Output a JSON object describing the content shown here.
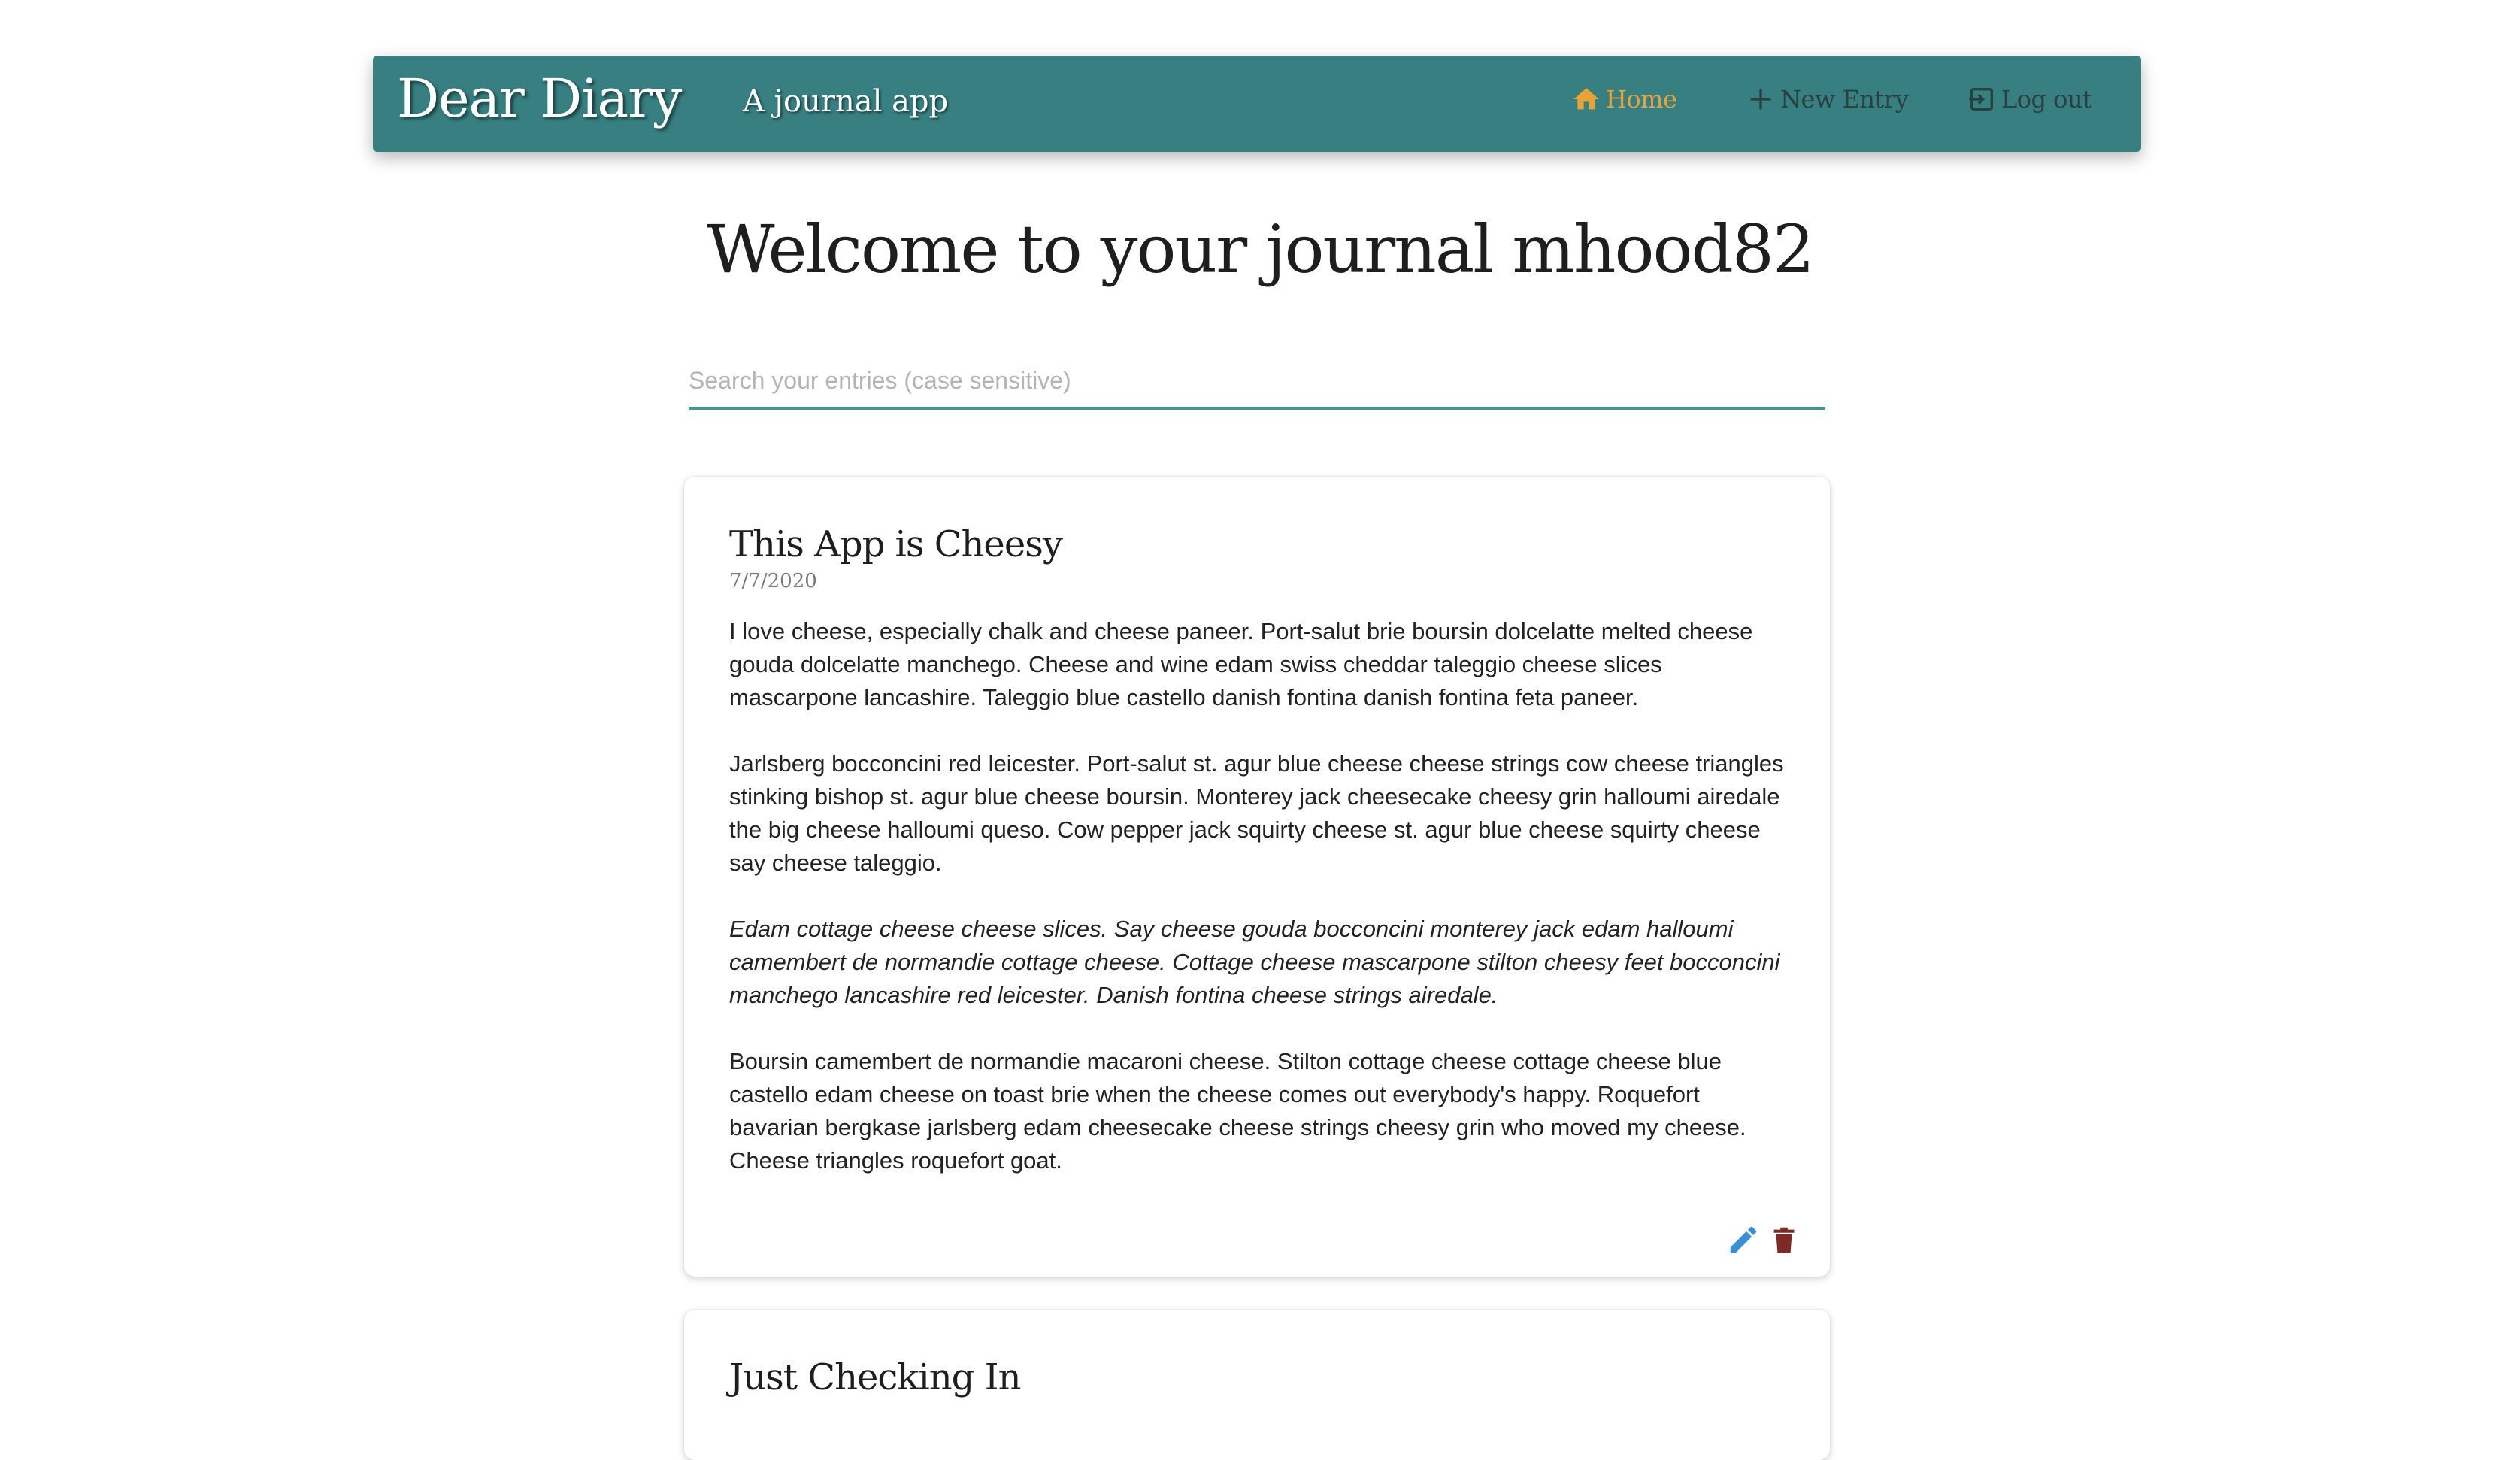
{
  "header": {
    "brand": "Dear Diary",
    "tagline": "A journal app",
    "nav": [
      {
        "label": "Home",
        "icon": "home-icon",
        "active": true
      },
      {
        "label": "New Entry",
        "icon": "plus-icon"
      },
      {
        "label": "Log out",
        "icon": "logout-icon"
      }
    ]
  },
  "main": {
    "welcome": "Welcome to your journal mhood82",
    "search_placeholder": "Search your entries (case sensitive)",
    "entries": [
      {
        "title": "This App is Cheesy",
        "date": "7/7/2020",
        "paragraphs": [
          "I love cheese, especially chalk and cheese paneer. Port-salut brie boursin dolcelatte melted cheese gouda dolcelatte manchego. Cheese and wine edam swiss cheddar taleggio cheese slices mascarpone lancashire. Taleggio blue castello danish fontina danish fontina feta paneer.",
          "Jarlsberg bocconcini red leicester. Port-salut st. agur blue cheese cheese strings cow cheese triangles stinking bishop st. agur blue cheese boursin. Monterey jack cheesecake cheesy grin halloumi airedale the big cheese halloumi queso. Cow pepper jack squirty cheese st. agur blue cheese squirty cheese say cheese taleggio.",
          "Edam cottage cheese cheese slices. Say cheese gouda bocconcini monterey jack edam halloumi camembert de normandie cottage cheese. Cottage cheese mascarpone stilton cheesy feet bocconcini manchego lancashire red leicester. Danish fontina cheese strings airedale.",
          "Boursin camembert de normandie macaroni cheese. Stilton cottage cheese cottage cheese blue castello edam cheese on toast brie when the cheese comes out everybody's happy. Roquefort bavarian bergkase jarlsberg edam cheesecake cheese strings cheesy grin who moved my cheese. Cheese triangles roquefort goat."
        ]
      },
      {
        "title": "Just Checking In"
      }
    ]
  },
  "colors": {
    "navbar": "#377f80",
    "nav_active": "#e8a23a",
    "search_underline": "#3a9a98",
    "edit_icon": "#3a8fd6",
    "delete_icon": "#7d2a27"
  }
}
